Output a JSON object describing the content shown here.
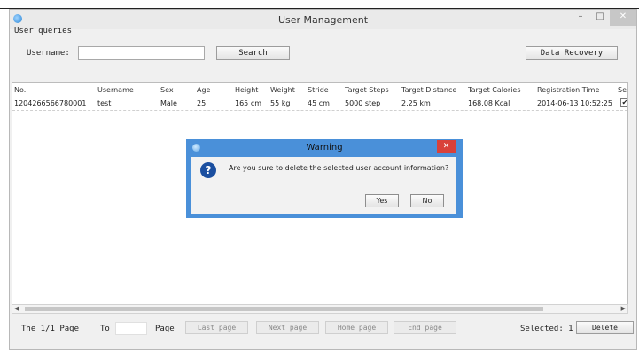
{
  "window": {
    "title": "User Management",
    "minimize": "–",
    "maximize": "□",
    "close": "✕"
  },
  "query": {
    "section_label": "User queries",
    "username_label": "Username:",
    "username_value": "",
    "search_label": "Search",
    "recovery_label": "Data Recovery"
  },
  "table": {
    "headers": [
      "No.",
      "Username",
      "Sex",
      "Age",
      "Height",
      "Weight",
      "Stride",
      "Target Steps",
      "Target Distance",
      "Target Calories",
      "Registration Time",
      "Sele"
    ],
    "rows": [
      [
        "1204266566780001",
        "test",
        "Male",
        "25",
        "165 cm",
        "55 kg",
        "45 cm",
        "5000 step",
        "2.25 km",
        "168.08 Kcal",
        "2014-06-13 10:52:25",
        "✔"
      ]
    ]
  },
  "footer": {
    "page_info": "The 1/1 Page",
    "to_label": "To",
    "page_label": "Page",
    "last_page": "Last page",
    "next_page": "Next page",
    "home_page": "Home page",
    "end_page": "End page",
    "selected": "Selected: 1",
    "delete": "Delete"
  },
  "dialog": {
    "title": "Warning",
    "close": "✕",
    "icon_glyph": "?",
    "message": "Are you sure to delete the selected user account information?",
    "yes": "Yes",
    "no": "No"
  }
}
